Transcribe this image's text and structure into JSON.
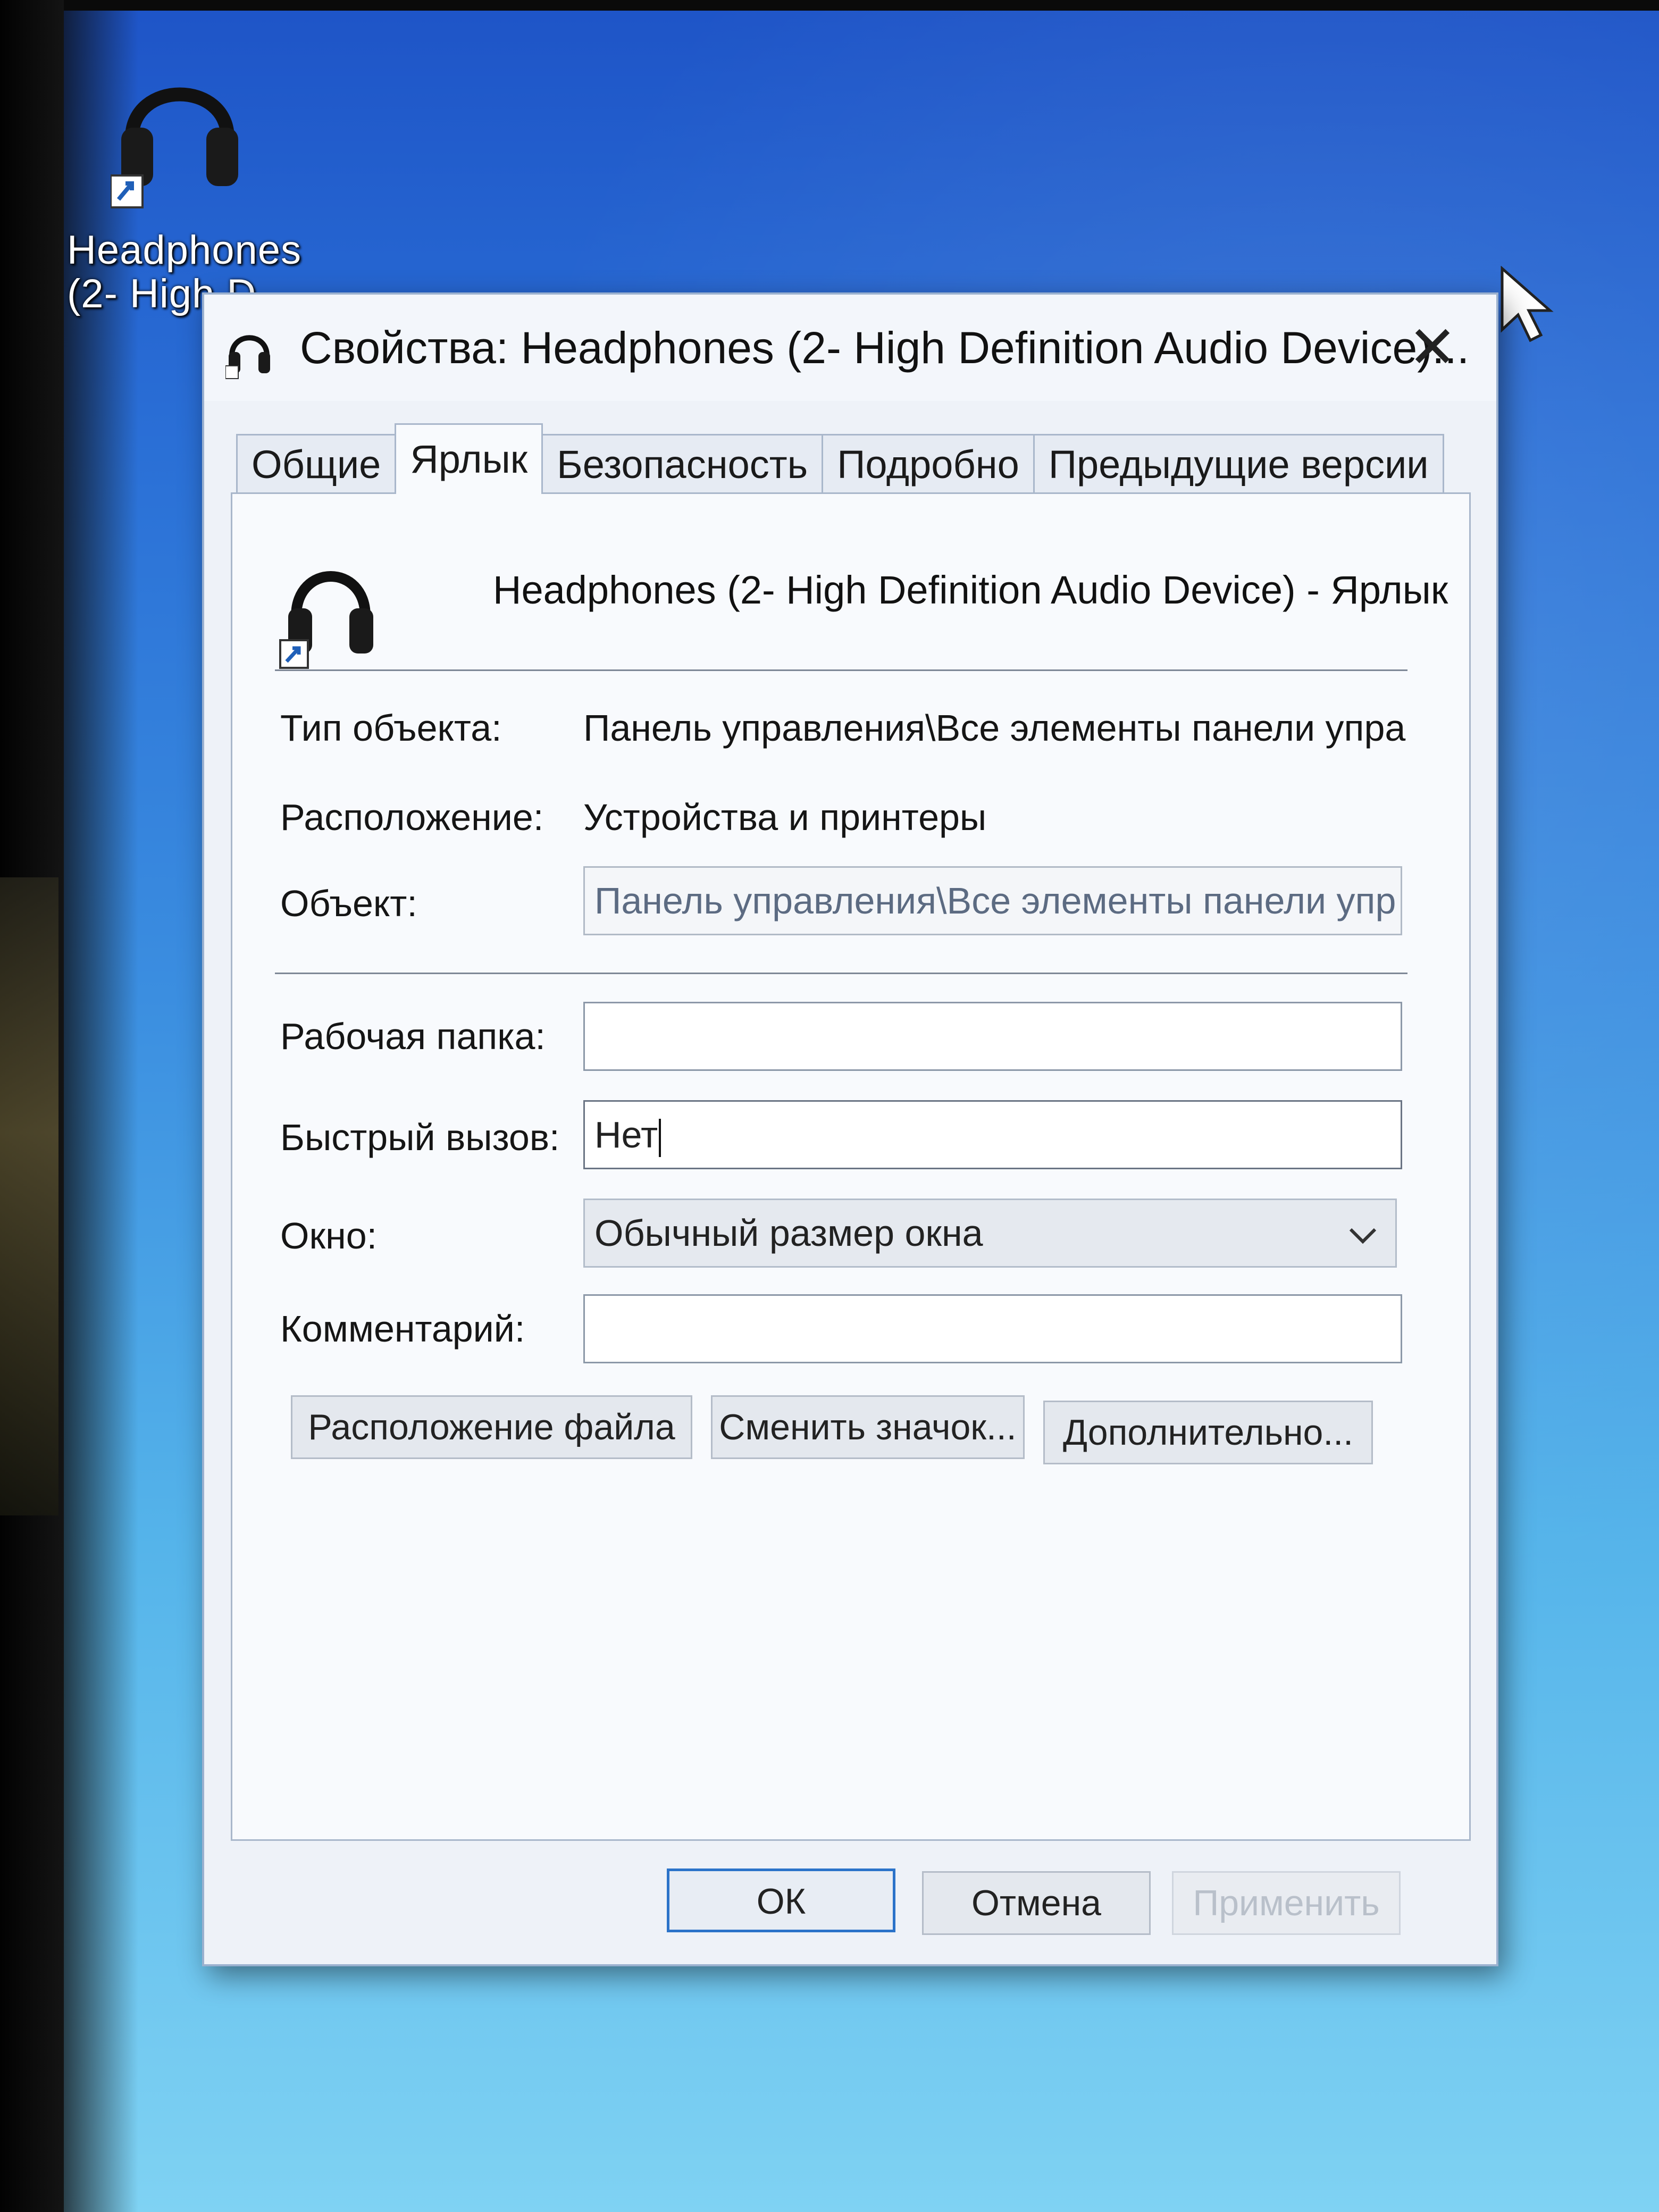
{
  "desktop": {
    "icon_label_line1": "Headphones",
    "icon_label_line2": "(2- High D"
  },
  "dialog": {
    "title": "Свойства: Headphones (2- High Definition Audio Device)...",
    "close_glyph": "✕",
    "tabs": [
      {
        "label": "Общие",
        "active": false
      },
      {
        "label": "Ярлык",
        "active": true
      },
      {
        "label": "Безопасность",
        "active": false
      },
      {
        "label": "Подробно",
        "active": false
      },
      {
        "label": "Предыдущие версии",
        "active": false
      }
    ],
    "shortcut_name": "Headphones (2- High Definition Audio Device) - Ярлык",
    "fields": {
      "type_label": "Тип объекта:",
      "type_value": "Панель управления\\Все элементы панели упра",
      "location_label": "Расположение:",
      "location_value": "Устройства и принтеры",
      "target_label": "Объект:",
      "target_value": "Панель управления\\Все элементы панели упр",
      "start_in_label": "Рабочая папка:",
      "start_in_value": "",
      "hotkey_label": "Быстрый вызов:",
      "hotkey_value": "Нет",
      "window_label": "Окно:",
      "window_value": "Обычный размер окна",
      "comment_label": "Комментарий:",
      "comment_value": ""
    },
    "buttons": {
      "open_location": "Расположение файла",
      "change_icon": "Сменить значок...",
      "advanced": "Дополнительно...",
      "ok": "ОК",
      "cancel": "Отмена",
      "apply": "Применить"
    }
  },
  "icons": {
    "shortcut_icon": "headphones-icon",
    "title_icon": "headphones-icon",
    "dropdown": "chevron-down-icon",
    "pointer": "mouse-pointer-icon"
  },
  "colors": {
    "desktop_top": "#1e54c7",
    "desktop_bottom": "#7fd2f3",
    "dialog_bg": "#eef2f8",
    "default_button_border": "#2b73c9"
  }
}
